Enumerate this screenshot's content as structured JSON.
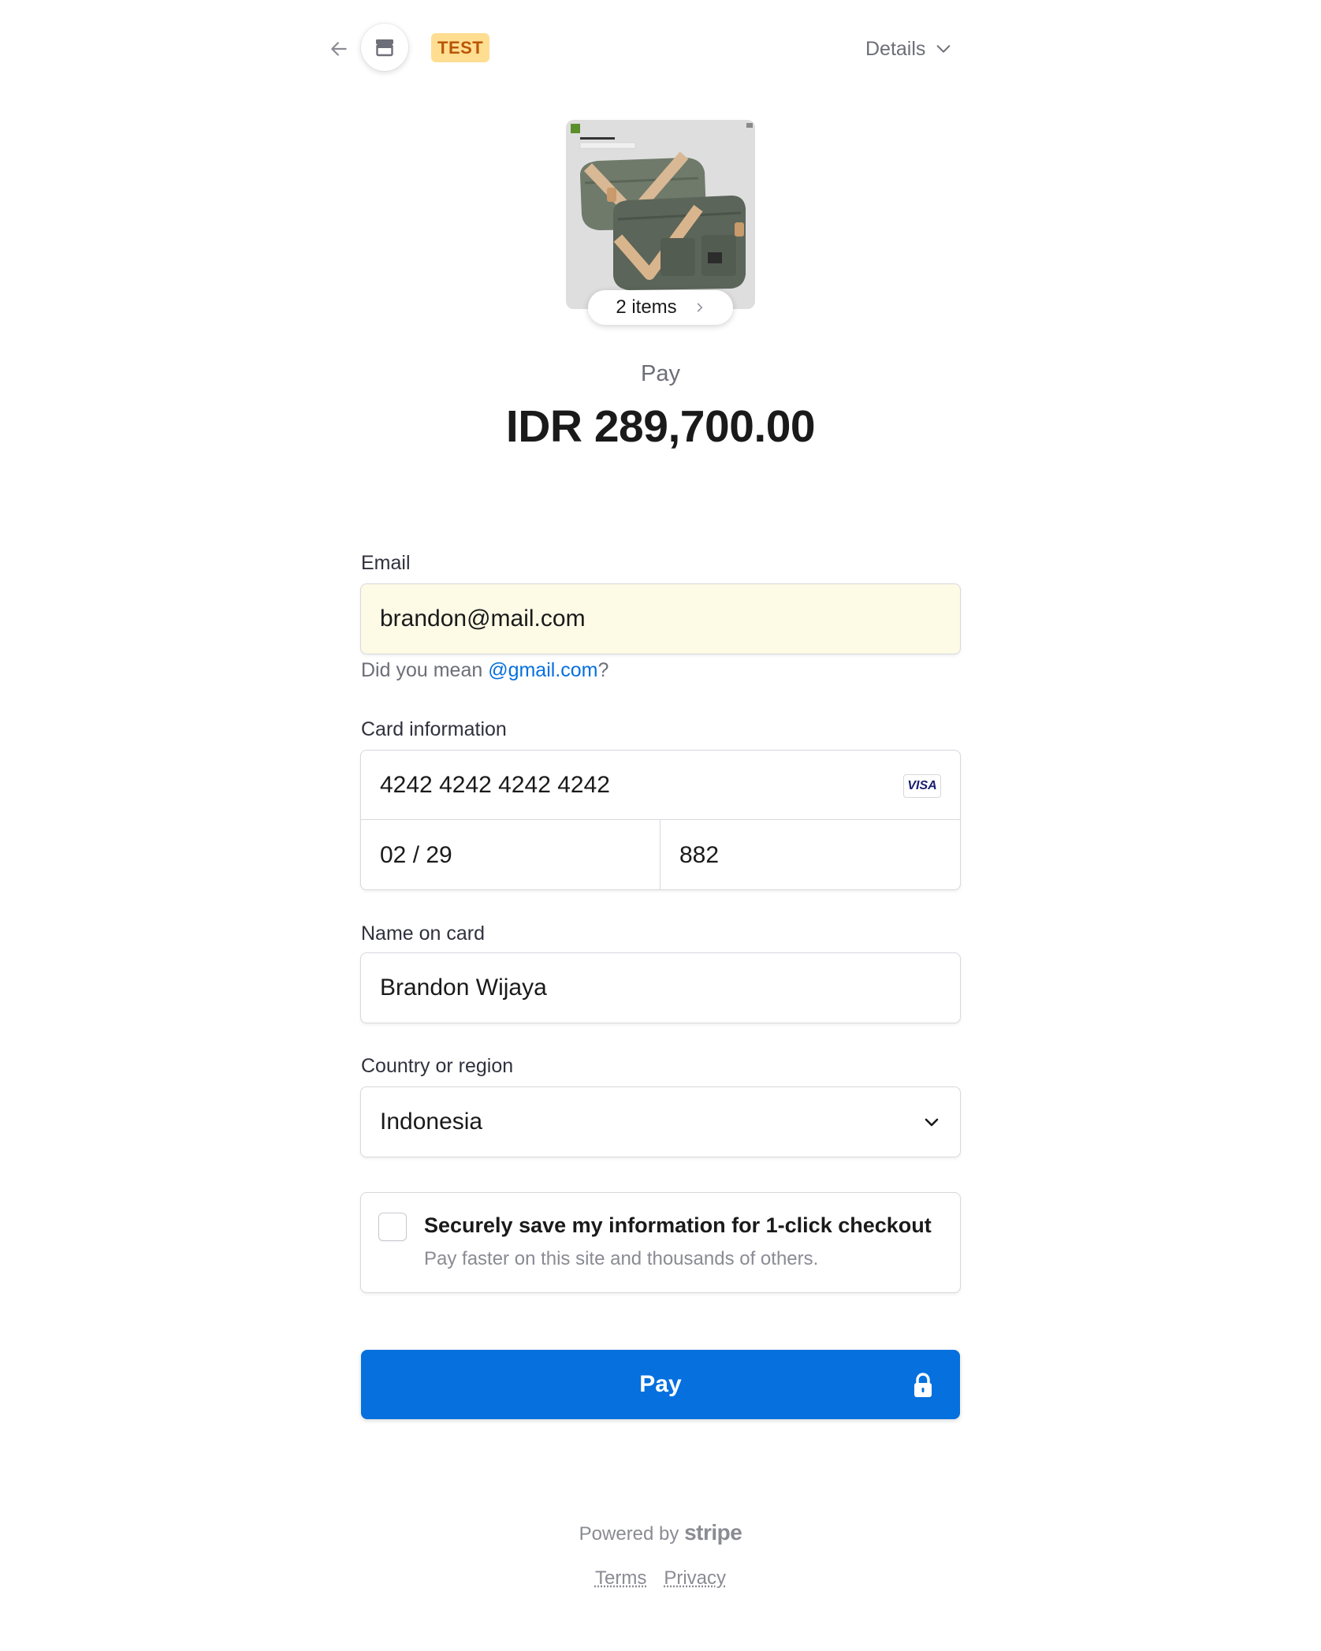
{
  "header": {
    "back_icon": "arrow-left-icon",
    "store_icon": "store-icon",
    "test_badge": "TEST",
    "details_label": "Details",
    "details_icon": "chevron-down-icon"
  },
  "product": {
    "items_label": "2 items",
    "items_icon": "chevron-right-icon",
    "image_brand": "FOURTYFOUR"
  },
  "summary": {
    "caption": "Pay",
    "amount": "IDR 289,700.00"
  },
  "form": {
    "email": {
      "label": "Email",
      "value": "brandon@mail.com",
      "hint_prefix": "Did you mean ",
      "hint_link": "@gmail.com",
      "hint_suffix": "?"
    },
    "card": {
      "label": "Card information",
      "number": "4242 4242 4242 4242",
      "brand": "VISA",
      "expiry": "02 / 29",
      "cvc": "882"
    },
    "name": {
      "label": "Name on card",
      "value": "Brandon Wijaya"
    },
    "country": {
      "label": "Country or region",
      "value": "Indonesia",
      "icon": "chevron-down-icon"
    },
    "save": {
      "checked": false,
      "title": "Securely save my information for 1-click checkout",
      "subtitle": "Pay faster on this site and thousands of others."
    }
  },
  "pay_button": {
    "label": "Pay",
    "icon": "lock-icon",
    "color": "#0570de"
  },
  "footer": {
    "powered_prefix": "Powered by",
    "powered_brand": "stripe",
    "terms": "Terms",
    "privacy": "Privacy"
  },
  "colors": {
    "accent": "#0570de",
    "test_badge_bg": "#ffde92",
    "test_badge_text": "#bb5504",
    "autofill_bg": "#fdfbe6"
  }
}
